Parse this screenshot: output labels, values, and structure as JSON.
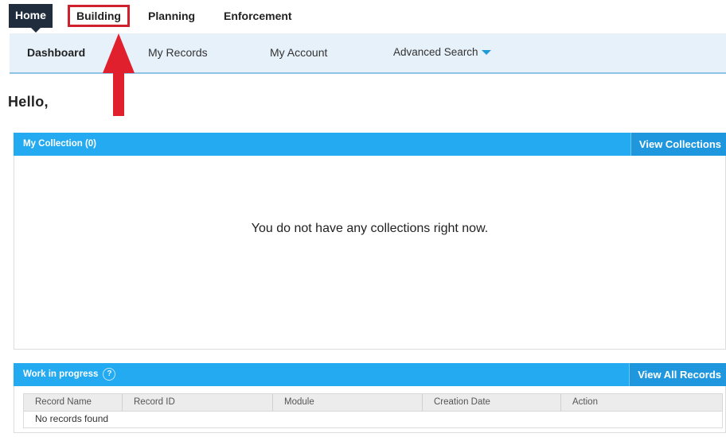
{
  "modules": {
    "home": "Home",
    "building": "Building",
    "planning": "Planning",
    "enforcement": "Enforcement"
  },
  "subnav": {
    "dashboard": "Dashboard",
    "my_records": "My Records",
    "my_account": "My Account",
    "advanced_search": "Advanced Search"
  },
  "greeting": "Hello,",
  "collection": {
    "title": "My Collection (0)",
    "view_button": "View Collections",
    "empty_message": "You do not have any collections right now."
  },
  "work_in_progress": {
    "title": "Work in progress",
    "help_icon_label": "?",
    "view_button": "View All Records",
    "columns": [
      "Record Name",
      "Record ID",
      "Module",
      "Creation Date",
      "Action"
    ],
    "empty_message": "No records found"
  },
  "colors": {
    "panel_header": "#23aaf0",
    "panel_button": "#1f97de",
    "home_tab": "#1f2d3d",
    "highlight": "#d0202d",
    "subnav_bg": "#e6f1fa"
  },
  "icons": {
    "annotation": "red-up-arrow",
    "help": "question-circle-icon",
    "dropdown": "caret-down-icon"
  }
}
